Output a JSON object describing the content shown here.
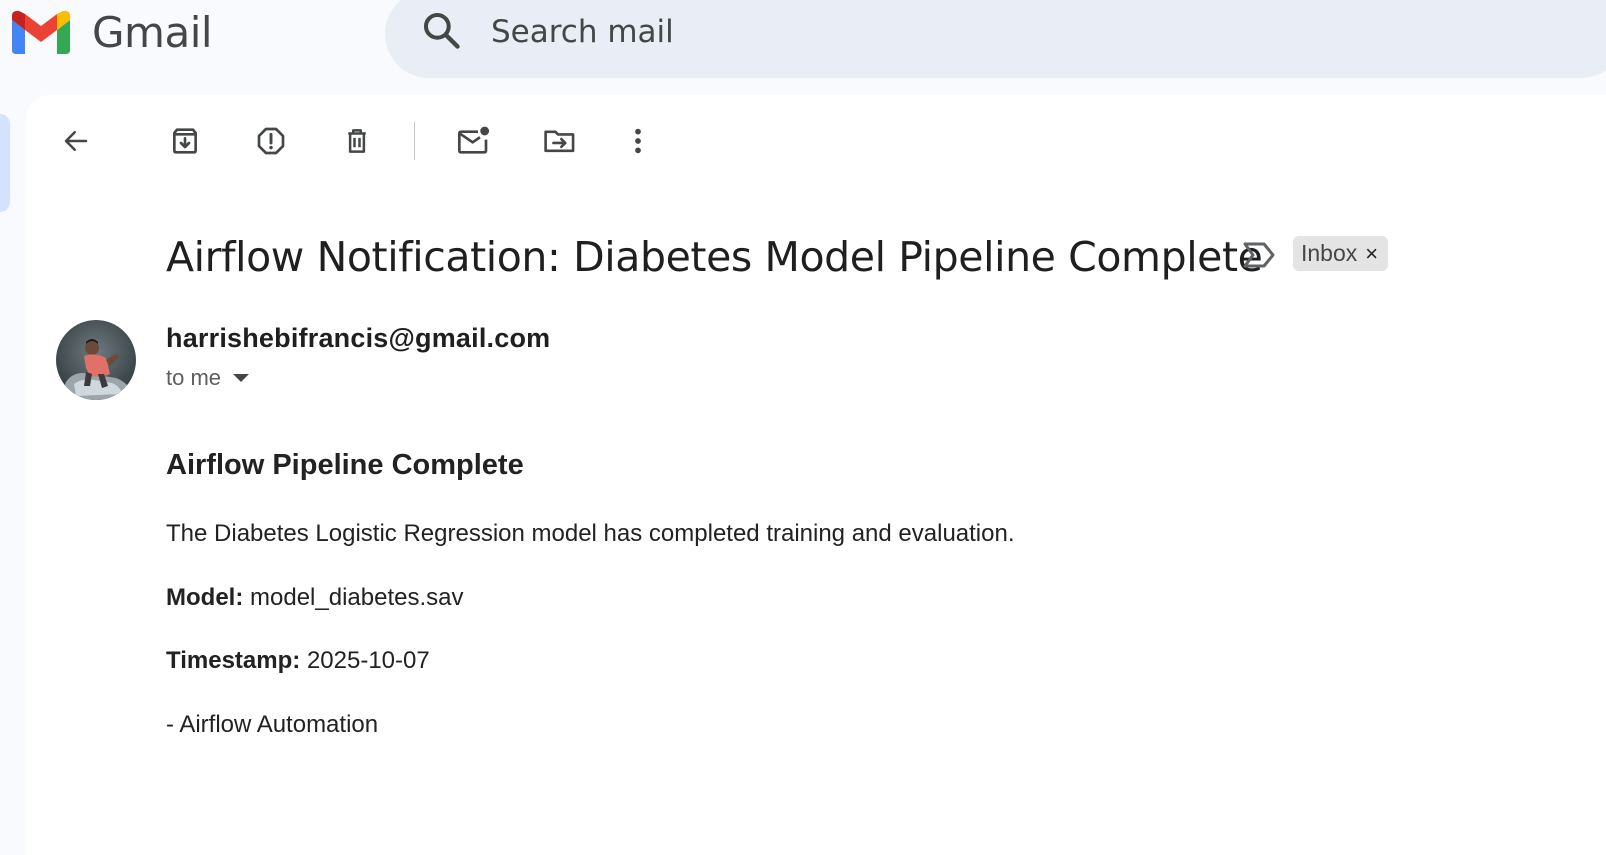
{
  "app": {
    "name": "Gmail"
  },
  "search": {
    "placeholder": "Search mail"
  },
  "toolbar": {
    "back": "back-arrow-icon",
    "archive": "archive-icon",
    "report_spam": "report-spam-icon",
    "delete": "delete-icon",
    "mark_unread": "mark-unread-icon",
    "move_to": "move-to-icon",
    "more": "more-vert-icon"
  },
  "email": {
    "subject": "Airflow Notification: Diabetes Model Pipeline Complete",
    "label_chip": "Inbox",
    "label_chip_remove": "×",
    "sender": "harrishebifrancis@gmail.com",
    "recipient": "to me",
    "body": {
      "heading": "Airflow Pipeline Complete",
      "intro": "The Diabetes Logistic Regression model has completed training and evaluation.",
      "model_label": "Model:",
      "model_value": "model_diabetes.sav",
      "timestamp_label": "Timestamp:",
      "timestamp_value": "2025-10-07",
      "signature": "- Airflow Automation"
    }
  },
  "colors": {
    "page_bg": "#f8fafd",
    "search_bg": "#e9eef6",
    "panel_bg": "#ffffff",
    "chip_bg": "#e4e4e4",
    "icon": "#444746",
    "gmail_red": "#ea4335",
    "gmail_blue": "#4285f4",
    "gmail_green": "#34a853",
    "gmail_yellow": "#fbbc04",
    "gmail_darkred": "#c5221f"
  }
}
